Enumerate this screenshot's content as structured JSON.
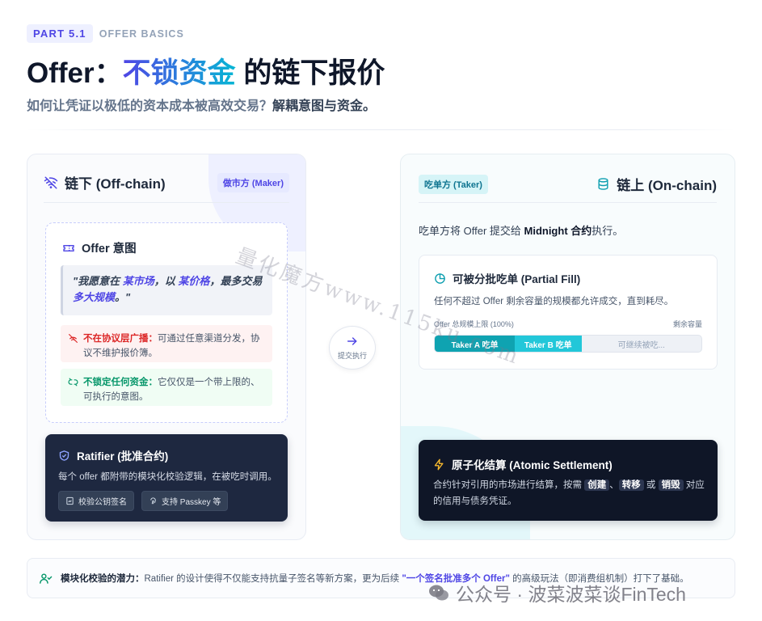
{
  "header": {
    "part_badge": "PART 5.1",
    "part_sub": "OFFER BASICS",
    "title_pre": "Offer：",
    "title_accent": "不锁资金",
    "title_post": " 的链下报价",
    "subtitle_pre": "如何让凭证以极低的资本成本被高效交易？",
    "subtitle_strong": "解耦意图与资金。"
  },
  "left_card": {
    "title": "链下 (Off-chain)",
    "role": "做市方 (Maker)",
    "intent": {
      "title": "Offer 意图",
      "quote": {
        "p1": "\"我愿意在 ",
        "h1": "某市场",
        "p2": "，以 ",
        "h2": "某价格",
        "p3": "，最多交易 ",
        "h3": "多大规模",
        "p4": "。\""
      },
      "note_red": {
        "lead": "不在协议层广播：",
        "text": "可通过任意渠道分发，协议不维护报价簿。"
      },
      "note_green": {
        "lead": "不锁定任何资金：",
        "text": "它仅仅是一个带上限的、可执行的意图。"
      }
    },
    "ratifier": {
      "title": "Ratifier (批准合约)",
      "desc": "每个 offer 都附带的模块化校验逻辑，在被吃时调用。",
      "chip1": "校验公钥签名",
      "chip2": "支持 Passkey 等"
    }
  },
  "connector": {
    "label": "提交执行"
  },
  "right_card": {
    "title": "链上 (On-chain)",
    "role": "吃单方 (Taker)",
    "desc_pre": "吃单方将 Offer 提交给 ",
    "desc_strong": "Midnight 合约",
    "desc_post": "执行。",
    "partial_fill": {
      "title": "可被分批吃单 (Partial Fill)",
      "desc": "任何不超过 Offer 剩余容量的规模都允许成交，直到耗尽。",
      "scale_left": "Offer 总规模上限 (100%)",
      "scale_right": "剩余容量",
      "segments": [
        {
          "label": "Taker A 吃单",
          "fraction": 0.3
        },
        {
          "label": "Taker B 吃单",
          "fraction": 0.25
        },
        {
          "label": "可继续被吃...",
          "fraction": 0.45
        }
      ]
    },
    "atomic": {
      "title": "原子化结算 (Atomic Settlement)",
      "p1": "合约针对引用的市场进行结算，按需 ",
      "k1": "创建",
      "p2": "、",
      "k2": "转移",
      "p3": " 或 ",
      "k3": "销毁",
      "p4": " 对应的信用与债务凭证。"
    }
  },
  "footer": {
    "lead": "模块化校验的潜力：",
    "text1": "Ratifier 的设计使得不仅能支持抗量子签名等新方案，更为后续 ",
    "highlight": "\"一个签名批准多个 Offer\"",
    "text2": " 的高级玩法（即消费组机制）打下了基础。"
  },
  "overlays": {
    "watermark": "量化魔方www.115ku.com",
    "wechat": "公众号 · 波菜波菜谈FinTech"
  },
  "colors": {
    "accent_indigo": "#4f46e5",
    "accent_cyan": "#06b6d4",
    "dark_card": "#1e2840",
    "red": "#dc2626",
    "green": "#059669"
  }
}
